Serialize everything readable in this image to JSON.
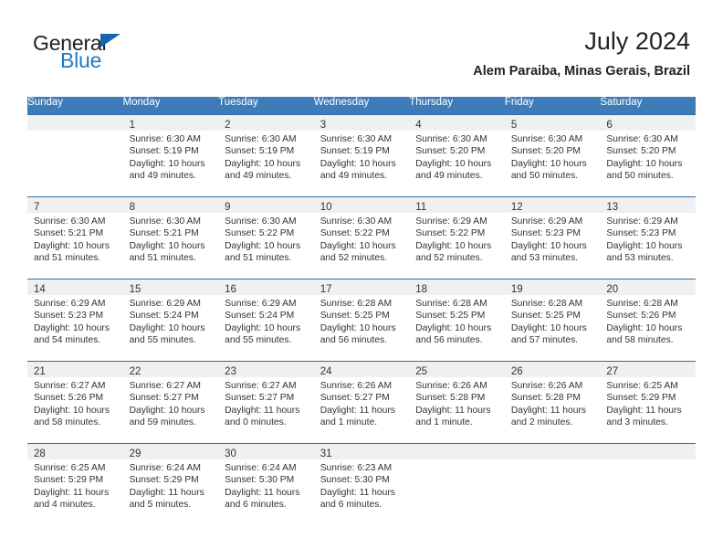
{
  "brand": {
    "name_part1": "General",
    "name_part2": "Blue",
    "accent_color": "#1f7ac4",
    "triangle_color": "#1565b0"
  },
  "header": {
    "title": "July 2024",
    "subtitle": "Alem Paraiba, Minas Gerais, Brazil"
  },
  "theme": {
    "header_row_bg": "#3e7cb9",
    "row_divider": "#2e6da4",
    "daynum_band_bg": "#f0f0f0"
  },
  "weekdays": [
    "Sunday",
    "Monday",
    "Tuesday",
    "Wednesday",
    "Thursday",
    "Friday",
    "Saturday"
  ],
  "weeks": [
    [
      {
        "day": ""
      },
      {
        "day": "1",
        "sunrise": "Sunrise: 6:30 AM",
        "sunset": "Sunset: 5:19 PM",
        "daylight": "Daylight: 10 hours and 49 minutes."
      },
      {
        "day": "2",
        "sunrise": "Sunrise: 6:30 AM",
        "sunset": "Sunset: 5:19 PM",
        "daylight": "Daylight: 10 hours and 49 minutes."
      },
      {
        "day": "3",
        "sunrise": "Sunrise: 6:30 AM",
        "sunset": "Sunset: 5:19 PM",
        "daylight": "Daylight: 10 hours and 49 minutes."
      },
      {
        "day": "4",
        "sunrise": "Sunrise: 6:30 AM",
        "sunset": "Sunset: 5:20 PM",
        "daylight": "Daylight: 10 hours and 49 minutes."
      },
      {
        "day": "5",
        "sunrise": "Sunrise: 6:30 AM",
        "sunset": "Sunset: 5:20 PM",
        "daylight": "Daylight: 10 hours and 50 minutes."
      },
      {
        "day": "6",
        "sunrise": "Sunrise: 6:30 AM",
        "sunset": "Sunset: 5:20 PM",
        "daylight": "Daylight: 10 hours and 50 minutes."
      }
    ],
    [
      {
        "day": "7",
        "sunrise": "Sunrise: 6:30 AM",
        "sunset": "Sunset: 5:21 PM",
        "daylight": "Daylight: 10 hours and 51 minutes."
      },
      {
        "day": "8",
        "sunrise": "Sunrise: 6:30 AM",
        "sunset": "Sunset: 5:21 PM",
        "daylight": "Daylight: 10 hours and 51 minutes."
      },
      {
        "day": "9",
        "sunrise": "Sunrise: 6:30 AM",
        "sunset": "Sunset: 5:22 PM",
        "daylight": "Daylight: 10 hours and 51 minutes."
      },
      {
        "day": "10",
        "sunrise": "Sunrise: 6:30 AM",
        "sunset": "Sunset: 5:22 PM",
        "daylight": "Daylight: 10 hours and 52 minutes."
      },
      {
        "day": "11",
        "sunrise": "Sunrise: 6:29 AM",
        "sunset": "Sunset: 5:22 PM",
        "daylight": "Daylight: 10 hours and 52 minutes."
      },
      {
        "day": "12",
        "sunrise": "Sunrise: 6:29 AM",
        "sunset": "Sunset: 5:23 PM",
        "daylight": "Daylight: 10 hours and 53 minutes."
      },
      {
        "day": "13",
        "sunrise": "Sunrise: 6:29 AM",
        "sunset": "Sunset: 5:23 PM",
        "daylight": "Daylight: 10 hours and 53 minutes."
      }
    ],
    [
      {
        "day": "14",
        "sunrise": "Sunrise: 6:29 AM",
        "sunset": "Sunset: 5:23 PM",
        "daylight": "Daylight: 10 hours and 54 minutes."
      },
      {
        "day": "15",
        "sunrise": "Sunrise: 6:29 AM",
        "sunset": "Sunset: 5:24 PM",
        "daylight": "Daylight: 10 hours and 55 minutes."
      },
      {
        "day": "16",
        "sunrise": "Sunrise: 6:29 AM",
        "sunset": "Sunset: 5:24 PM",
        "daylight": "Daylight: 10 hours and 55 minutes."
      },
      {
        "day": "17",
        "sunrise": "Sunrise: 6:28 AM",
        "sunset": "Sunset: 5:25 PM",
        "daylight": "Daylight: 10 hours and 56 minutes."
      },
      {
        "day": "18",
        "sunrise": "Sunrise: 6:28 AM",
        "sunset": "Sunset: 5:25 PM",
        "daylight": "Daylight: 10 hours and 56 minutes."
      },
      {
        "day": "19",
        "sunrise": "Sunrise: 6:28 AM",
        "sunset": "Sunset: 5:25 PM",
        "daylight": "Daylight: 10 hours and 57 minutes."
      },
      {
        "day": "20",
        "sunrise": "Sunrise: 6:28 AM",
        "sunset": "Sunset: 5:26 PM",
        "daylight": "Daylight: 10 hours and 58 minutes."
      }
    ],
    [
      {
        "day": "21",
        "sunrise": "Sunrise: 6:27 AM",
        "sunset": "Sunset: 5:26 PM",
        "daylight": "Daylight: 10 hours and 58 minutes."
      },
      {
        "day": "22",
        "sunrise": "Sunrise: 6:27 AM",
        "sunset": "Sunset: 5:27 PM",
        "daylight": "Daylight: 10 hours and 59 minutes."
      },
      {
        "day": "23",
        "sunrise": "Sunrise: 6:27 AM",
        "sunset": "Sunset: 5:27 PM",
        "daylight": "Daylight: 11 hours and 0 minutes."
      },
      {
        "day": "24",
        "sunrise": "Sunrise: 6:26 AM",
        "sunset": "Sunset: 5:27 PM",
        "daylight": "Daylight: 11 hours and 1 minute."
      },
      {
        "day": "25",
        "sunrise": "Sunrise: 6:26 AM",
        "sunset": "Sunset: 5:28 PM",
        "daylight": "Daylight: 11 hours and 1 minute."
      },
      {
        "day": "26",
        "sunrise": "Sunrise: 6:26 AM",
        "sunset": "Sunset: 5:28 PM",
        "daylight": "Daylight: 11 hours and 2 minutes."
      },
      {
        "day": "27",
        "sunrise": "Sunrise: 6:25 AM",
        "sunset": "Sunset: 5:29 PM",
        "daylight": "Daylight: 11 hours and 3 minutes."
      }
    ],
    [
      {
        "day": "28",
        "sunrise": "Sunrise: 6:25 AM",
        "sunset": "Sunset: 5:29 PM",
        "daylight": "Daylight: 11 hours and 4 minutes."
      },
      {
        "day": "29",
        "sunrise": "Sunrise: 6:24 AM",
        "sunset": "Sunset: 5:29 PM",
        "daylight": "Daylight: 11 hours and 5 minutes."
      },
      {
        "day": "30",
        "sunrise": "Sunrise: 6:24 AM",
        "sunset": "Sunset: 5:30 PM",
        "daylight": "Daylight: 11 hours and 6 minutes."
      },
      {
        "day": "31",
        "sunrise": "Sunrise: 6:23 AM",
        "sunset": "Sunset: 5:30 PM",
        "daylight": "Daylight: 11 hours and 6 minutes."
      },
      {
        "day": ""
      },
      {
        "day": ""
      },
      {
        "day": ""
      }
    ]
  ]
}
